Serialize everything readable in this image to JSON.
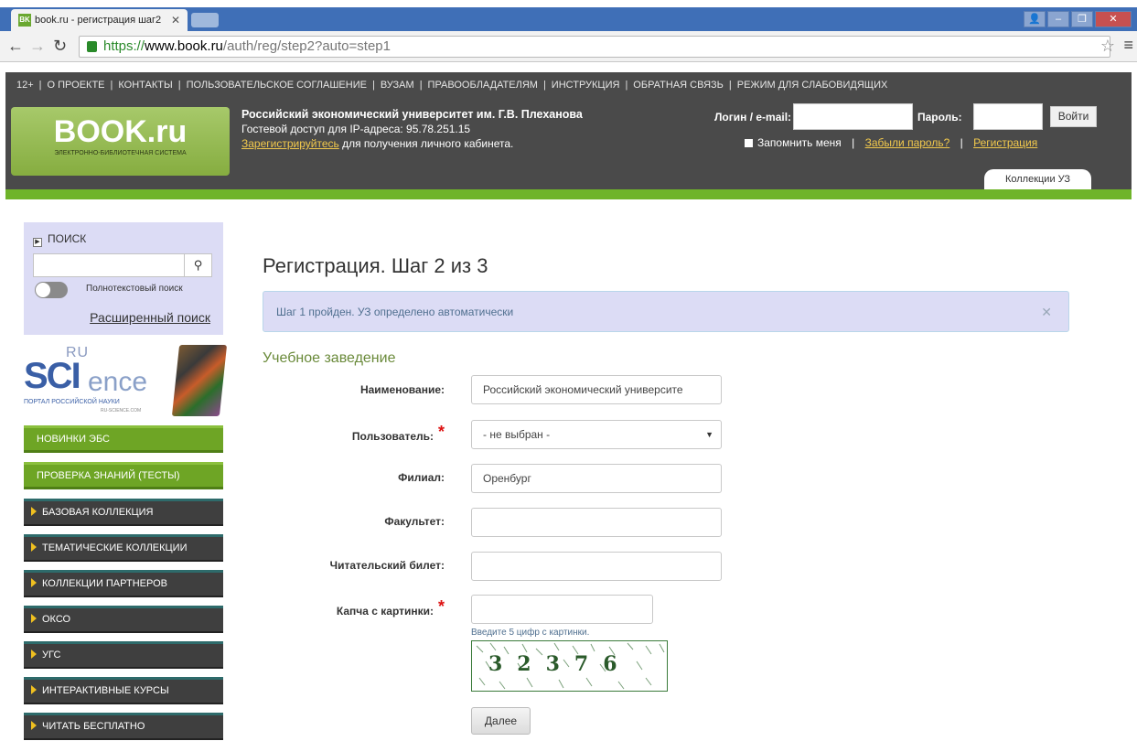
{
  "browser": {
    "tab_title": "book.ru - регистрация шаг2",
    "tab_favicon": "BK",
    "url_https": "https://",
    "url_host": "www.book.ru",
    "url_path": "/auth/reg/step2?auto=step1"
  },
  "header": {
    "topnav": [
      "12+",
      "О ПРОЕКТЕ",
      "КОНТАКТЫ",
      "ПОЛЬЗОВАТЕЛЬСКОЕ СОГЛАШЕНИЕ",
      "ВУЗАМ",
      "ПРАВООБЛАДАТЕЛЯМ",
      "ИНСТРУКЦИЯ",
      "ОБРАТНАЯ СВЯЗЬ",
      "РЕЖИМ ДЛЯ СЛАБОВИДЯЩИХ"
    ],
    "logo_big": "BOOK.ru",
    "logo_small": "ЭЛЕКТРОННО-БИБЛИОТЕЧНАЯ СИСТЕМА",
    "university": "Российский экономический университет им. Г.В. Плеханова",
    "guest_access": "Гостевой доступ для IP-адреса: 95.78.251.15",
    "register_link": "Зарегистрируйтесь",
    "register_suffix": " для получения личного кабинета.",
    "login_label": "Логин / e-mail:",
    "password_label": "Пароль:",
    "login_button": "Войти",
    "remember_me": "Запомнить меня",
    "forgot_password": "Забыли пароль?",
    "registration": "Регистрация",
    "collections_tab": "Коллекции УЗ",
    "accent_green": "#6fb42a"
  },
  "sidebar": {
    "search_head": "ПОИСК",
    "search_icon": "magnifier-icon",
    "fulltext_label": "Полнотекстовый поиск",
    "advanced_search": "Расширенный поиск",
    "science_ru": "RU",
    "science_sci": "SCI",
    "science_ence": "ence",
    "science_portal": "ПОРТАЛ РОССИЙСКОЙ НАУКИ",
    "science_url": "RU-SCIENCE.COM",
    "menu_green": [
      "НОВИНКИ ЭБС",
      "ПРОВЕРКА ЗНАНИЙ (ТЕСТЫ)"
    ],
    "menu_dark": [
      "БАЗОВАЯ КОЛЛЕКЦИЯ",
      "ТЕМАТИЧЕСКИЕ КОЛЛЕКЦИИ",
      "КОЛЛЕКЦИИ ПАРТНЕРОВ",
      "ОКСО",
      "УГС",
      "ИНТЕРАКТИВНЫЕ КУРСЫ",
      "ЧИТАТЬ БЕСПЛАТНО"
    ]
  },
  "main": {
    "title": "Регистрация. Шаг 2 из 3",
    "alert": "Шаг 1 пройден. УЗ определено автоматически",
    "section": "Учебное заведение",
    "fields": {
      "name_label": "Наименование:",
      "name_value": "Российский экономический университе",
      "user_label": "Пользователь:",
      "user_value": "- не выбран -",
      "branch_label": "Филиал:",
      "branch_value": "Оренбург",
      "faculty_label": "Факультет:",
      "faculty_value": "",
      "card_label": "Читательский билет:",
      "card_value": "",
      "captcha_label": "Капча с картинки:",
      "captcha_value": "",
      "captcha_hint": "Введите 5 цифр с картинки.",
      "captcha_digits": "32376"
    },
    "next_button": "Далее"
  }
}
